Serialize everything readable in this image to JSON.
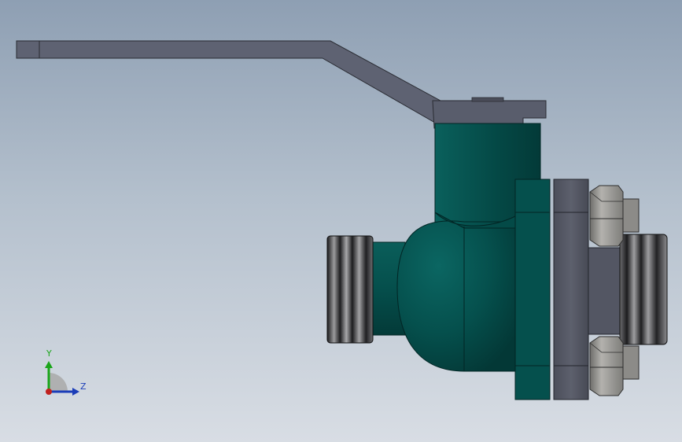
{
  "scene": {
    "subject": "ball-valve-3d-model",
    "background_top": "#8e9fb3",
    "background_bottom": "#d8dde4",
    "colors": {
      "body": "#05504d",
      "body_dark": "#033a38",
      "handle": "#5c6070",
      "handle_dark": "#3e414d",
      "flange": "#585b68",
      "nut": "#8f8e8a",
      "thread_dark": "#1d1d1f",
      "thread_light": "#9a9a9c"
    }
  },
  "triad": {
    "y_label": "Y",
    "z_label": "Z",
    "colors": {
      "y": "#1aa51a",
      "z": "#1b3db8",
      "x_origin": "#c0211e"
    }
  }
}
